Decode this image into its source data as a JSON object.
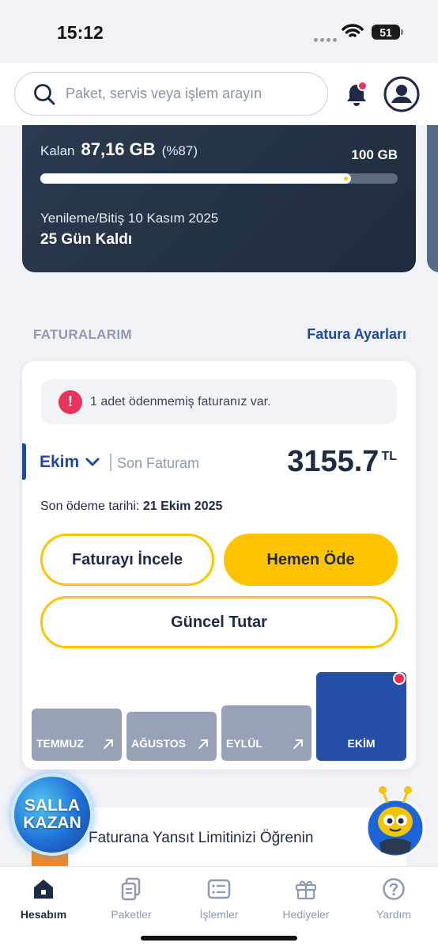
{
  "status_bar": {
    "time": "15:12",
    "battery": "51"
  },
  "header": {
    "search_placeholder": "Paket, servis veya işlem arayın",
    "icons": [
      "search-icon",
      "bell-icon",
      "profile-icon"
    ]
  },
  "data_card": {
    "remaining_label": "Kalan",
    "remaining_value": "87,16 GB",
    "remaining_percent": "(%87)",
    "total": "100 GB",
    "usage_fraction": 0.87,
    "renewal": "Yenileme/Bitiş 10 Kasım 2025",
    "days_left": "25 Gün Kaldı"
  },
  "bills_section": {
    "title": "FATURALARIM",
    "settings_link": "Fatura Ayarları"
  },
  "bill_card": {
    "alert_text": "1 adet ödenmemiş faturanız var.",
    "alert_icon": "!",
    "month": "Ekim",
    "last_bill_label": "Son Faturam",
    "amount": "3155.7",
    "currency": "TL",
    "due_label": "Son ödeme tarihi:",
    "due_date": "21 Ekim 2025",
    "btn_review": "Faturayı İncele",
    "btn_pay": "Hemen Öde",
    "btn_current": "Güncel Tutar",
    "months": [
      {
        "label": "TEMMUZ",
        "active": false
      },
      {
        "label": "AĞUSTOS",
        "active": false
      },
      {
        "label": "EYLÜL",
        "active": false
      },
      {
        "label": "EKİM",
        "active": true
      }
    ]
  },
  "promo": {
    "text": "Faturana Yansıt Limitinizi Öğrenin",
    "badge_line1": "SALLA",
    "badge_line2": "KAZAN"
  },
  "tabbar": {
    "items": [
      {
        "label": "Hesabım",
        "icon": "home-icon",
        "active": true
      },
      {
        "label": "Paketler",
        "icon": "packages-icon",
        "active": false
      },
      {
        "label": "İşlemler",
        "icon": "list-icon",
        "active": false
      },
      {
        "label": "Hediyeler",
        "icon": "gift-icon",
        "active": false
      },
      {
        "label": "Yardım",
        "icon": "help-icon",
        "active": false
      }
    ]
  },
  "colors": {
    "accent_yellow": "#ffc400",
    "brand_blue": "#1f4a9e",
    "alert_red": "#e8345a",
    "card_dark": "#243347"
  }
}
